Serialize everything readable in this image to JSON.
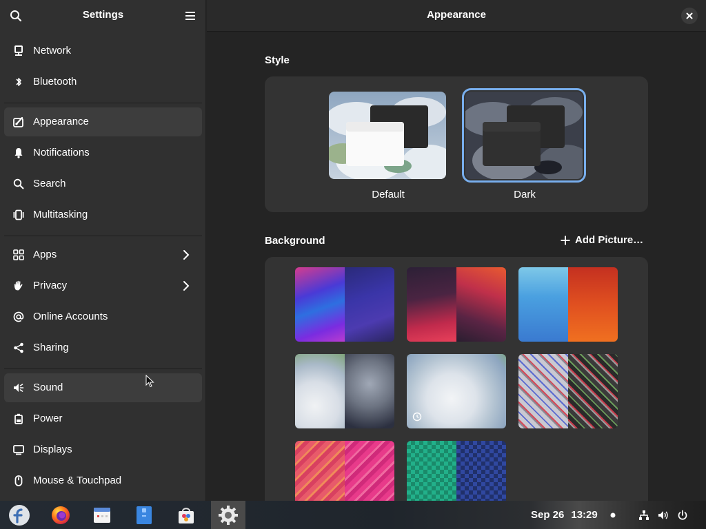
{
  "sidebar": {
    "title": "Settings",
    "items": [
      {
        "label": "Network",
        "icon": "network-icon"
      },
      {
        "label": "Bluetooth",
        "icon": "bluetooth-icon"
      },
      {
        "label": "Appearance",
        "icon": "appearance-icon",
        "selected": true
      },
      {
        "label": "Notifications",
        "icon": "bell-icon"
      },
      {
        "label": "Search",
        "icon": "search-icon"
      },
      {
        "label": "Multitasking",
        "icon": "multitasking-icon"
      },
      {
        "label": "Apps",
        "icon": "apps-grid-icon",
        "has_submenu": true
      },
      {
        "label": "Privacy",
        "icon": "hand-icon",
        "has_submenu": true
      },
      {
        "label": "Online Accounts",
        "icon": "at-sign-icon"
      },
      {
        "label": "Sharing",
        "icon": "share-icon"
      },
      {
        "label": "Sound",
        "icon": "speaker-icon"
      },
      {
        "label": "Power",
        "icon": "battery-icon"
      },
      {
        "label": "Displays",
        "icon": "display-icon"
      },
      {
        "label": "Mouse & Touchpad",
        "icon": "mouse-icon"
      }
    ]
  },
  "main": {
    "title": "Appearance",
    "style": {
      "heading": "Style",
      "options": [
        {
          "label": "Default",
          "selected": false
        },
        {
          "label": "Dark",
          "selected": true
        }
      ]
    },
    "background": {
      "heading": "Background",
      "add_button": "Add Picture…"
    }
  },
  "taskbar": {
    "apps": [
      "fedora-logo-icon",
      "firefox-icon",
      "calendar-icon",
      "text-editor-icon",
      "software-store-icon",
      "settings-gear-icon"
    ],
    "date": "Sep 26",
    "time": "13:29"
  },
  "colors": {
    "accent": "#78aeed",
    "sidebar_bg": "#303030",
    "content_bg": "#242424",
    "card_bg": "#333333"
  }
}
